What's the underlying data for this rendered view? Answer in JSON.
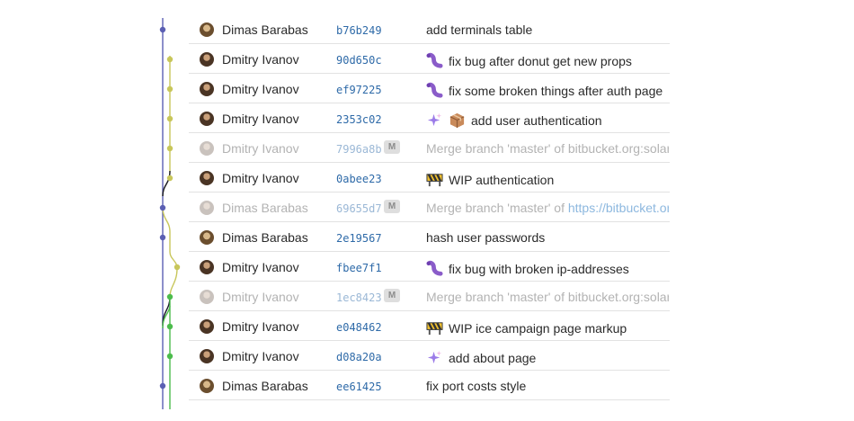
{
  "commits": [
    {
      "author": "Dimas Barabas",
      "hash": "b76b249",
      "emojis": [],
      "message": "add terminals table",
      "merge": false
    },
    {
      "author": "Dmitry Ivanov",
      "hash": "90d650c",
      "emojis": [
        "caterpillar-icon"
      ],
      "message": "fix bug after donut get new props",
      "merge": false
    },
    {
      "author": "Dmitry Ivanov",
      "hash": "ef97225",
      "emojis": [
        "caterpillar-icon"
      ],
      "message": "fix some broken things after auth page",
      "merge": false
    },
    {
      "author": "Dmitry Ivanov",
      "hash": "2353c02",
      "emojis": [
        "sparkles-icon",
        "package-icon"
      ],
      "message": "add user authentication",
      "merge": false
    },
    {
      "author": "Dmitry Ivanov",
      "hash": "7996a8b",
      "badge": "M",
      "emojis": [],
      "message": "Merge branch 'master' of bitbucket.org:solar",
      "merge": true
    },
    {
      "author": "Dmitry Ivanov",
      "hash": "0abee23",
      "emojis": [
        "construction-icon"
      ],
      "message": "WIP authentication",
      "merge": false
    },
    {
      "author": "Dimas Barabas",
      "hash": "69655d7",
      "badge": "M",
      "emojis": [],
      "message": "Merge branch 'master' of ",
      "link": "https://bitbucket.or",
      "merge": true
    },
    {
      "author": "Dimas Barabas",
      "hash": "2e19567",
      "emojis": [],
      "message": "hash user passwords",
      "merge": false
    },
    {
      "author": "Dmitry Ivanov",
      "hash": "fbee7f1",
      "emojis": [
        "caterpillar-icon"
      ],
      "message": "fix bug with broken ip-addresses",
      "merge": false
    },
    {
      "author": "Dmitry Ivanov",
      "hash": "1ec8423",
      "badge": "M",
      "emojis": [],
      "message": "Merge branch 'master' of bitbucket.org:solar",
      "merge": true
    },
    {
      "author": "Dmitry Ivanov",
      "hash": "e048462",
      "emojis": [
        "construction-icon"
      ],
      "message": "WIP ice campaign page markup",
      "merge": false
    },
    {
      "author": "Dmitry Ivanov",
      "hash": "d08a20a",
      "emojis": [
        "sparkles-icon"
      ],
      "message": "add about page",
      "merge": false
    },
    {
      "author": "Dimas Barabas",
      "hash": "ee61425",
      "emojis": [],
      "message": "fix port costs style",
      "merge": false
    }
  ],
  "colors": {
    "lane_blue": "#5b5fb3",
    "lane_olive": "#c8c65a",
    "lane_green": "#4cbc4c",
    "hash": "#2e6aa8"
  }
}
